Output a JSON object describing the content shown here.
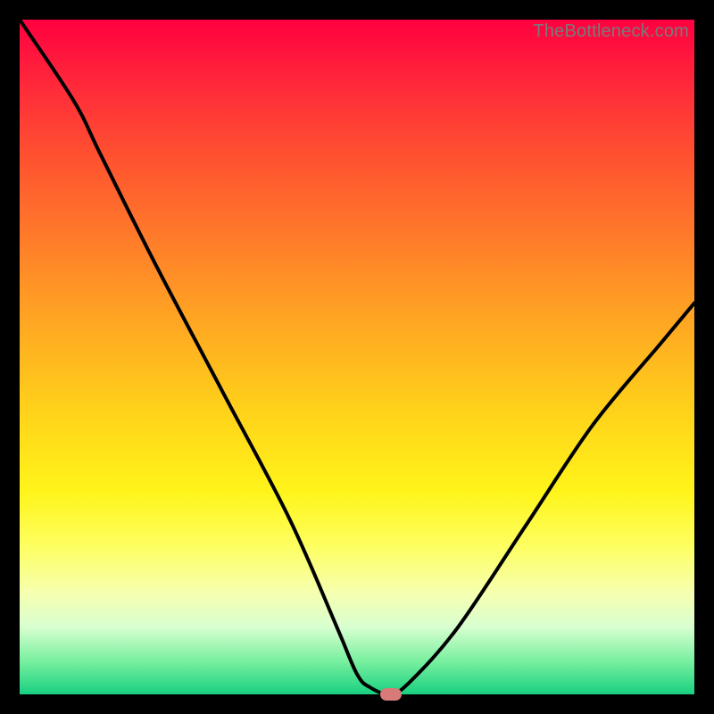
{
  "watermark": "TheBottleneck.com",
  "chart_data": {
    "type": "line",
    "title": "",
    "xlabel": "",
    "ylabel": "",
    "xlim": [
      0,
      100
    ],
    "ylim": [
      0,
      100
    ],
    "grid": false,
    "legend": false,
    "background": "vertical-rainbow-gradient",
    "series": [
      {
        "name": "bottleneck-curve",
        "x": [
          0,
          8,
          12,
          20,
          30,
          40,
          47,
          50,
          52,
          55,
          58,
          65,
          75,
          85,
          95,
          100
        ],
        "values": [
          100,
          88,
          80,
          64,
          45,
          26,
          10,
          3,
          1,
          0,
          2,
          10,
          25,
          40,
          52,
          58
        ]
      }
    ],
    "marker": {
      "x": 55,
      "y": 0,
      "color": "#d87a78",
      "shape": "pill"
    },
    "colors": {
      "curve": "#000000",
      "frame": "#000000",
      "gradient_stops": [
        "#ff0040",
        "#ff7a2a",
        "#ffd21a",
        "#fdff60",
        "#7af0a0",
        "#18d080"
      ]
    }
  }
}
